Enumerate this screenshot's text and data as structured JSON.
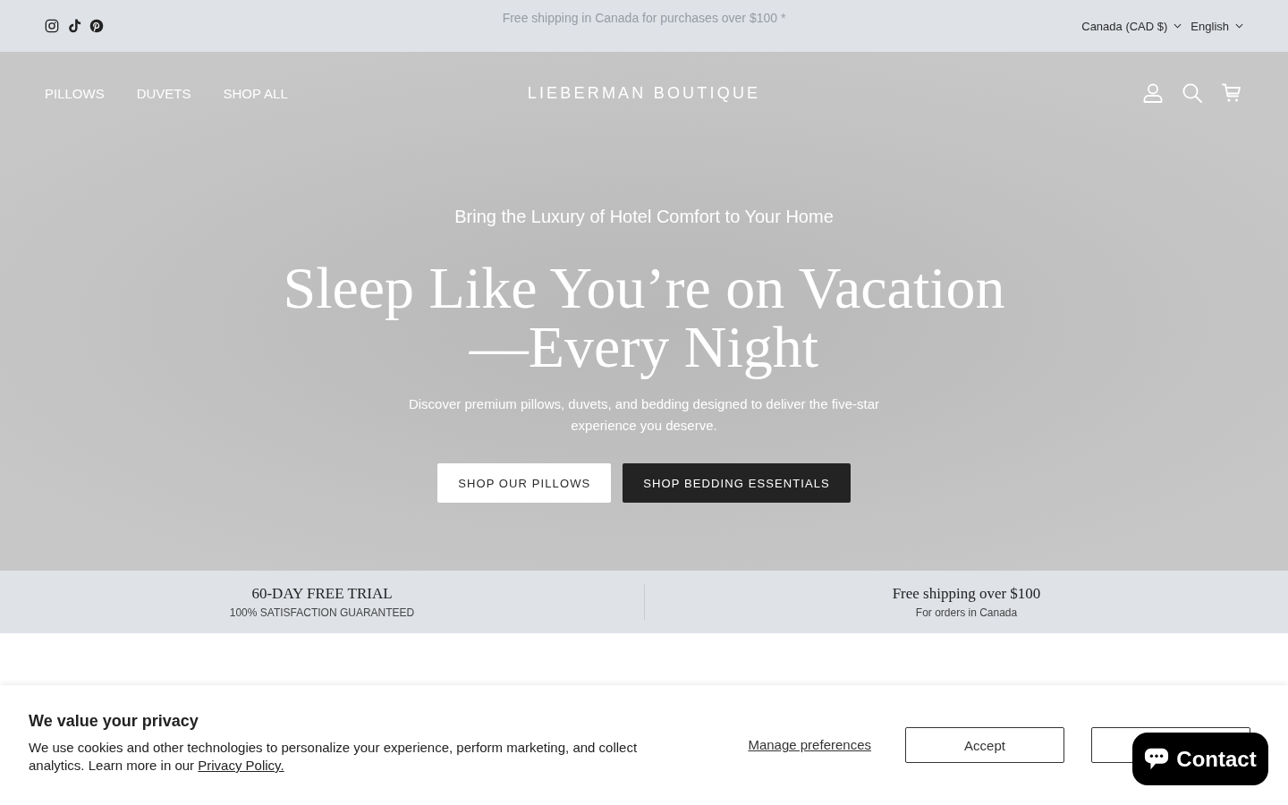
{
  "announcement_bar": {
    "social_links": [
      {
        "kind": "camera"
      },
      {
        "kind": "note"
      },
      {
        "kind": "pin"
      }
    ],
    "message": "Free shipping in Canada for purchases over $100 *",
    "selectors": [
      "Canada (CAD $)",
      "English"
    ]
  },
  "header": {
    "nav": [
      "PILLOWS",
      "DUVETS",
      "SHOP ALL"
    ],
    "logo": "LIEBERMAN BOUTIQUE",
    "icons": [
      {
        "kind": "account"
      },
      {
        "kind": "search"
      },
      {
        "kind": "cart"
      }
    ]
  },
  "hero": {
    "eyebrow": "Bring the Luxury of Hotel Comfort to Your Home",
    "title": "Sleep Like You’re on Vacation—Every Night",
    "text": "Discover premium pillows, duvets, and bedding designed to deliver the five-star experience you deserve.",
    "buttons": [
      {
        "label": "SHOP OUR PILLOWS",
        "kind": "light"
      },
      {
        "label": "SHOP BEDDING ESSENTIALS",
        "kind": "dark"
      }
    ]
  },
  "features": [
    {
      "title": "60-DAY FREE TRIAL",
      "subtitle": "100% SATISFACTION GUARANTEED"
    },
    {
      "title": "Free shipping over $100",
      "subtitle": "For orders in Canada"
    }
  ],
  "cookie_banner": {
    "title": "We value your privacy",
    "text": "We use cookies and other technologies to personalize your experience, perform marketing, and collect analytics. Learn more in our",
    "link": "Privacy Policy.",
    "manage_link": "Manage preferences",
    "buttons": [
      {
        "kind": "outline",
        "label": "Accept"
      },
      {
        "kind": "outline"
      }
    ]
  },
  "chat_button": {
    "label": "Contact"
  }
}
